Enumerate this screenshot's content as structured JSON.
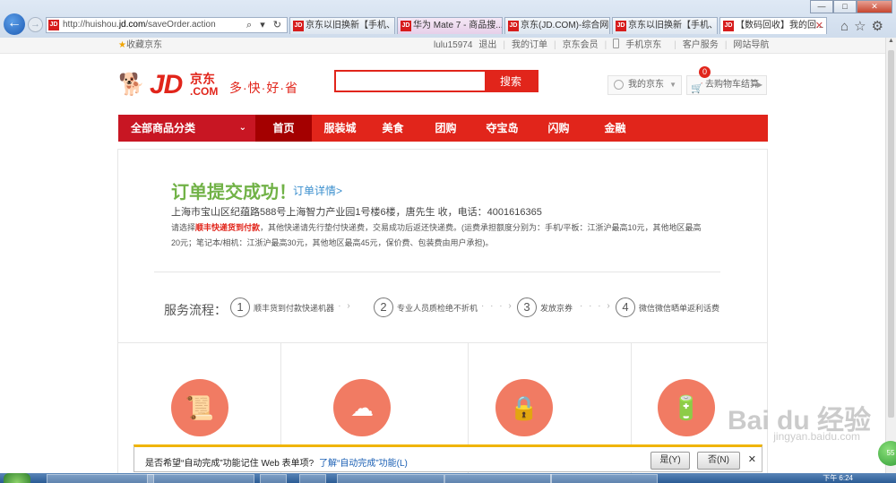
{
  "browser": {
    "url_prefix": "http://huishou.",
    "url_domain": "jd.com",
    "url_path": "/saveOrder.action",
    "addr_tools": "⌕ ▾ ↻",
    "tabs": [
      {
        "label": "京东以旧换新【手机、...",
        "type": "jd"
      },
      {
        "label": "华为 Mate 7 - 商品搜...",
        "type": "huawei"
      },
      {
        "label": "京东(JD.COM)-综合网...",
        "type": "jd"
      },
      {
        "label": "京东以旧换新【手机、...",
        "type": "jd"
      },
      {
        "label": "【数码回收】我的回...",
        "type": "jd-active"
      }
    ],
    "window_buttons": [
      "—",
      "□",
      "✕"
    ]
  },
  "topbar": {
    "favorite": "收藏京东",
    "user": "lulu15974",
    "logout": "退出",
    "my_orders": "我的订单",
    "member": "京东会员",
    "mobile": "手机京东",
    "service": "客户服务",
    "site_nav": "网站导航"
  },
  "logo": {
    "brand": "JD",
    "brand_cn": "京东",
    "brand_com": ".COM",
    "slogan": "多·快·好·省"
  },
  "search": {
    "placeholder": "",
    "button": "搜索"
  },
  "header": {
    "my_jd": "我的京东",
    "cart": "去购物车结算",
    "cart_count": "0"
  },
  "nav": {
    "categories": "全部商品分类",
    "items": [
      "首页",
      "服装城",
      "美食",
      "团购",
      "夺宝岛",
      "闪购",
      "金融"
    ]
  },
  "order": {
    "title": "订单提交成功！",
    "detail_link": "订单详情>",
    "address": "上海市宝山区纪蕴路588号上海智力产业园1号楼6楼，唐先生 收，电话：4001616365",
    "notice_prefix": "请选择",
    "notice_red": "顺丰快递货到付款",
    "notice_rest": "，其他快递请先行垫付快递费，交易成功后返还快递费。(运费承担额度分别为：手机/平板：江浙沪最高10元，其他地区最高20元；笔记本/相机：江浙沪最高30元，其他地区最高45元，保价费、包装费由用户承担)。"
  },
  "process": {
    "title": "服务流程：",
    "steps": [
      {
        "num": "1",
        "text": "顺丰货到付款快递机器"
      },
      {
        "num": "2",
        "text": "专业人员质检绝不折机"
      },
      {
        "num": "3",
        "text": "发放京券"
      },
      {
        "num": "4",
        "text": "微信微信晒单返利话费"
      }
    ],
    "dots": "· · · ›"
  },
  "cards": [
    "scroll-icon",
    "cloud-sync-icon",
    "lock-icon",
    "battery-icon"
  ],
  "autocomplete_bar": {
    "question": "是否希望“自动完成”功能记住 Web 表单项?",
    "learn_more": "了解“自动完成”功能(L)",
    "yes": "是(Y)",
    "no": "否(N)",
    "close": "✕"
  },
  "taskbar": {
    "clock": "下午 6:24"
  },
  "watermark": {
    "text": "Bai du 经验",
    "sub": "jingyan.baidu.com"
  },
  "colors": {
    "jd_red": "#e1251b",
    "nav_dark": "#c81623",
    "success_green": "#71b247",
    "link_blue": "#3b8fce",
    "card_icon": "#f17b63"
  }
}
